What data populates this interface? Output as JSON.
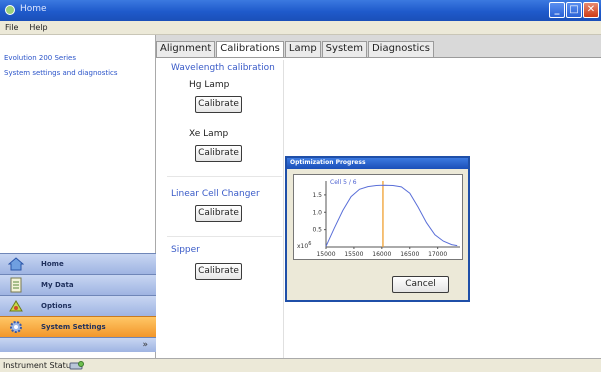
{
  "window": {
    "title": "Home"
  },
  "menu": [
    {
      "label": "File"
    },
    {
      "label": "Help"
    }
  ],
  "left_panel": {
    "links": [
      {
        "label": "Evolution 200 Series"
      },
      {
        "label": "System settings and diagnostics"
      }
    ],
    "nav": [
      {
        "label": "Home",
        "icon": "home-icon"
      },
      {
        "label": "My Data",
        "icon": "data-icon"
      },
      {
        "label": "Options",
        "icon": "options-icon"
      },
      {
        "label": "System Settings",
        "icon": "settings-icon",
        "active": true
      }
    ]
  },
  "status_bar": {
    "text": "Instrument Status",
    "icon": "instrument-icon"
  },
  "tabs": [
    {
      "label": "Alignment"
    },
    {
      "label": "Calibrations",
      "active": true
    },
    {
      "label": "Lamp"
    },
    {
      "label": "System"
    },
    {
      "label": "Diagnostics"
    }
  ],
  "calibrations": {
    "wavelength_title": "Wavelength calibration",
    "hg_label": "Hg Lamp",
    "xe_label": "Xe Lamp",
    "cell_changer_title": "Linear Cell Changer",
    "sipper_title": "Sipper",
    "calibrate_label": "Calibrate"
  },
  "dialog": {
    "title": "Optimization Progress",
    "cancel_label": "Cancel"
  },
  "chart_data": {
    "type": "line",
    "title": "Cell 5 / 6",
    "xlim": [
      15000,
      17400
    ],
    "ylim": [
      0,
      1.9
    ],
    "xticks": [
      "15000",
      "15500",
      "16000",
      "16500",
      "17000"
    ],
    "yticks": [
      "0.5",
      "1.0",
      "1.5"
    ],
    "y_multiplier": "x10^6",
    "marker_x": 16020,
    "series": [
      {
        "color": "#5a6fd8",
        "x": [
          15000,
          15150,
          15300,
          15450,
          15600,
          15750,
          15900,
          16050,
          16200,
          16350,
          16500,
          16650,
          16800,
          16950,
          17100,
          17250,
          17350
        ],
        "y": [
          0.02,
          0.55,
          1.05,
          1.45,
          1.66,
          1.74,
          1.77,
          1.78,
          1.77,
          1.73,
          1.55,
          1.15,
          0.7,
          0.35,
          0.17,
          0.07,
          0.04
        ]
      }
    ],
    "marker_color": "#f0a030"
  }
}
